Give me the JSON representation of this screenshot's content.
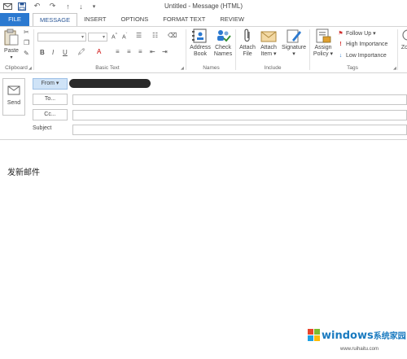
{
  "window": {
    "title": "Untitled - Message (HTML)"
  },
  "qat": {
    "icons": [
      "outlook-app-icon",
      "save-icon",
      "undo-icon",
      "redo-icon",
      "up-arrow-icon",
      "down-arrow-icon",
      "customize-icon"
    ]
  },
  "tabs": [
    {
      "label": "FILE"
    },
    {
      "label": "MESSAGE"
    },
    {
      "label": "INSERT"
    },
    {
      "label": "OPTIONS"
    },
    {
      "label": "FORMAT TEXT"
    },
    {
      "label": "REVIEW"
    }
  ],
  "ribbon": {
    "clipboard": {
      "paste_label": "Paste",
      "group_label": "Clipboard"
    },
    "basic_text": {
      "group_label": "Basic Text",
      "bold": "B",
      "italic": "I",
      "underline": "U"
    },
    "names": {
      "address_book_line1": "Address",
      "address_book_line2": "Book",
      "check_names_line1": "Check",
      "check_names_line2": "Names",
      "group_label": "Names"
    },
    "include": {
      "attach_file_line1": "Attach",
      "attach_file_line2": "File",
      "attach_item_line1": "Attach",
      "attach_item_line2": "Item ▾",
      "signature_line1": "Signature",
      "signature_line2": "▾",
      "group_label": "Include"
    },
    "tags": {
      "assign_policy_line1": "Assign",
      "assign_policy_line2": "Policy ▾",
      "follow_up": "Follow Up ▾",
      "high_importance": "High Importance",
      "low_importance": "Low Importance",
      "group_label": "Tags"
    },
    "zoom": {
      "label": "Zo"
    }
  },
  "compose": {
    "send_label": "Send",
    "from_label": "From ▾",
    "from_value": "                    ",
    "to_label": "To...",
    "cc_label": "Cc...",
    "subject_label": "Subject",
    "to_value": "",
    "cc_value": "",
    "subject_value": ""
  },
  "body": {
    "text": "发新邮件"
  },
  "watermark": {
    "brand": "windows",
    "brand_zh": "系统家园",
    "url": "www.ruihaitu.com"
  }
}
